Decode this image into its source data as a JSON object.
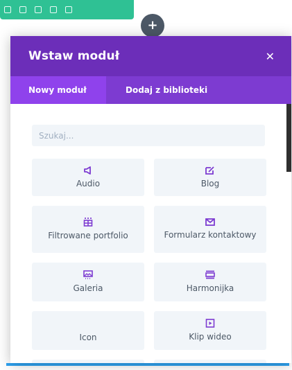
{
  "modal": {
    "title": "Wstaw moduł",
    "tabs": [
      {
        "label": "Nowy moduł",
        "active": true
      },
      {
        "label": "Dodaj z biblioteki",
        "active": false
      }
    ],
    "search_placeholder": "Szukaj...",
    "modules": [
      {
        "label": "Audio",
        "icon": "audio-icon"
      },
      {
        "label": "Blog",
        "icon": "blog-icon"
      },
      {
        "label": "Filtrowane portfolio",
        "icon": "filterable-portfolio-icon"
      },
      {
        "label": "Formularz kontaktowy",
        "icon": "contact-form-icon"
      },
      {
        "label": "Galeria",
        "icon": "gallery-icon"
      },
      {
        "label": "Harmonijka",
        "icon": "accordion-icon"
      },
      {
        "label": "Icon",
        "icon": "icon-icon"
      },
      {
        "label": "Klip wideo",
        "icon": "video-icon"
      }
    ]
  },
  "colors": {
    "header": "#6c2eb9",
    "tabs_bar": "#7d3bd1",
    "tab_active": "#8f42ec",
    "card_bg": "#f1f5f9",
    "accent": "#7d3bd1",
    "toolbar": "#2fc194"
  }
}
